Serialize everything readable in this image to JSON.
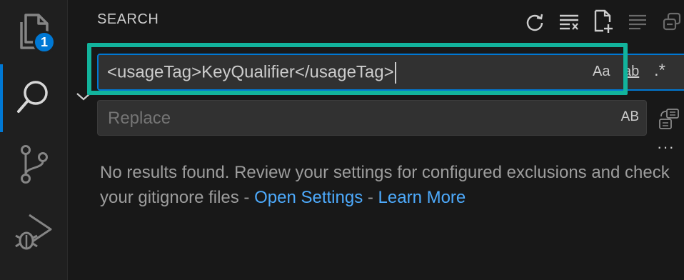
{
  "activity_bar": {
    "explorer_badge": "1",
    "items": [
      "explorer",
      "search",
      "source-control",
      "run-and-debug"
    ],
    "active": "search",
    "colors": {
      "accent": "#0078d4"
    }
  },
  "panel": {
    "title": "SEARCH",
    "actions": [
      "refresh-icon",
      "clear-results-icon",
      "new-search-editor-icon",
      "collapse-all-icon",
      "view-as-tree-icon"
    ]
  },
  "search": {
    "value": "<usageTag>KeyQualifier</usageTag>",
    "match_case_label": "Aa",
    "whole_word_label": "ab",
    "regex_label": ".*"
  },
  "replace": {
    "placeholder": "Replace",
    "preserve_case_label": "AB"
  },
  "more_label": "···",
  "results": {
    "message": "No results found. Review your settings for configured exclusions and check your gitignore files - ",
    "open_settings_label": "Open Settings",
    "separator": " - ",
    "learn_more_label": "Learn More"
  },
  "highlight": {
    "color": "#12b39c"
  }
}
